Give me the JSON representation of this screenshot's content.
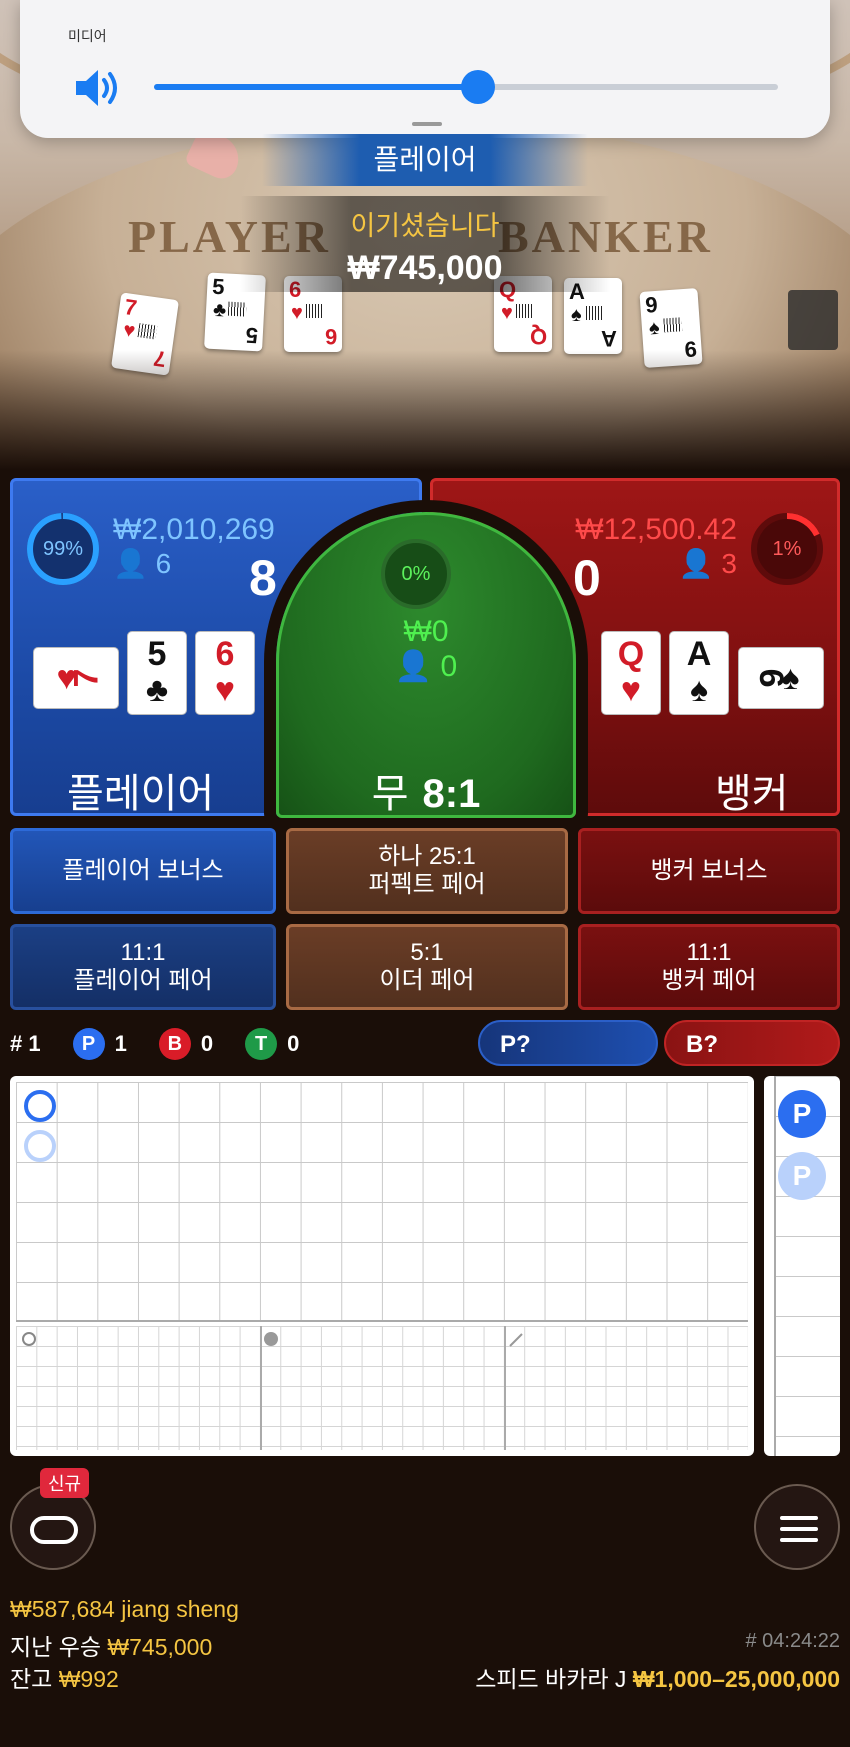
{
  "volume": {
    "title": "미디어",
    "level": 0.52
  },
  "scene": {
    "player_word": "PLAYER",
    "banker_word": "BANKER",
    "player_cards": [
      {
        "rank": "7",
        "suit": "♥",
        "color": "red"
      },
      {
        "rank": "5",
        "suit": "♣",
        "color": "black"
      },
      {
        "rank": "6",
        "suit": "♥",
        "color": "red"
      }
    ],
    "banker_cards": [
      {
        "rank": "Q",
        "suit": "♥",
        "color": "red"
      },
      {
        "rank": "A",
        "suit": "♠",
        "color": "black"
      },
      {
        "rank": "9",
        "suit": "♠",
        "color": "black"
      }
    ]
  },
  "result": {
    "winner_label": "플레이어",
    "win_text": "이기셨습니다",
    "win_amount": "₩745,000"
  },
  "bets": {
    "player": {
      "percent": "99%",
      "percent_value": 0.99,
      "amount": "₩2,010,269",
      "players": "6",
      "score": "8",
      "name": "플레이어",
      "cards": [
        {
          "rank": "7",
          "suit": "♥",
          "color": "red",
          "sideways": true
        },
        {
          "rank": "5",
          "suit": "♣",
          "color": "black",
          "sideways": false
        },
        {
          "rank": "6",
          "suit": "♥",
          "color": "red",
          "sideways": false
        }
      ]
    },
    "tie": {
      "percent": "0%",
      "amount": "₩0",
      "players": "0",
      "name": "무",
      "odds": "8:1"
    },
    "banker": {
      "percent": "1%",
      "percent_value": 0.01,
      "amount": "₩12,500.42",
      "players": "3",
      "score": "0",
      "name": "뱅커",
      "cards": [
        {
          "rank": "Q",
          "suit": "♥",
          "color": "red",
          "sideways": false
        },
        {
          "rank": "A",
          "suit": "♠",
          "color": "black",
          "sideways": false
        },
        {
          "rank": "9",
          "suit": "♠",
          "color": "black",
          "sideways": true
        }
      ]
    }
  },
  "side_bets": {
    "player_bonus": "플레이어 보너스",
    "perfect_pair_line1": "하나 25:1",
    "perfect_pair_line2": "퍼펙트 페어",
    "banker_bonus": "뱅커 보너스",
    "player_pair_odds": "11:1",
    "player_pair_label": "플레이어 페어",
    "either_pair_odds": "5:1",
    "either_pair_label": "이더 페어",
    "banker_pair_odds": "11:1",
    "banker_pair_label": "뱅커 페어"
  },
  "stats": {
    "round": "# 1",
    "p_label": "P",
    "p_count": "1",
    "b_label": "B",
    "b_count": "0",
    "t_label": "T",
    "t_count": "0"
  },
  "predict": {
    "player": "P?",
    "banker": "B?"
  },
  "roadmap": {
    "side_chip": "P"
  },
  "bottom": {
    "new_badge": "신규",
    "recent_winner": "₩587,684 jiang sheng",
    "last_win_label": "지난 우승",
    "last_win_amount": "₩745,000",
    "balance_label": "잔고",
    "balance_amount": "₩992",
    "clock": "# 04:24:22",
    "table_name": "스피드 바카라 J",
    "limits": "₩1,000–25,000,000"
  },
  "colors": {
    "player_blue": "#2b6ef0",
    "banker_red": "#d91c28",
    "tie_green": "#1f9a48",
    "gold": "#f5c542"
  }
}
